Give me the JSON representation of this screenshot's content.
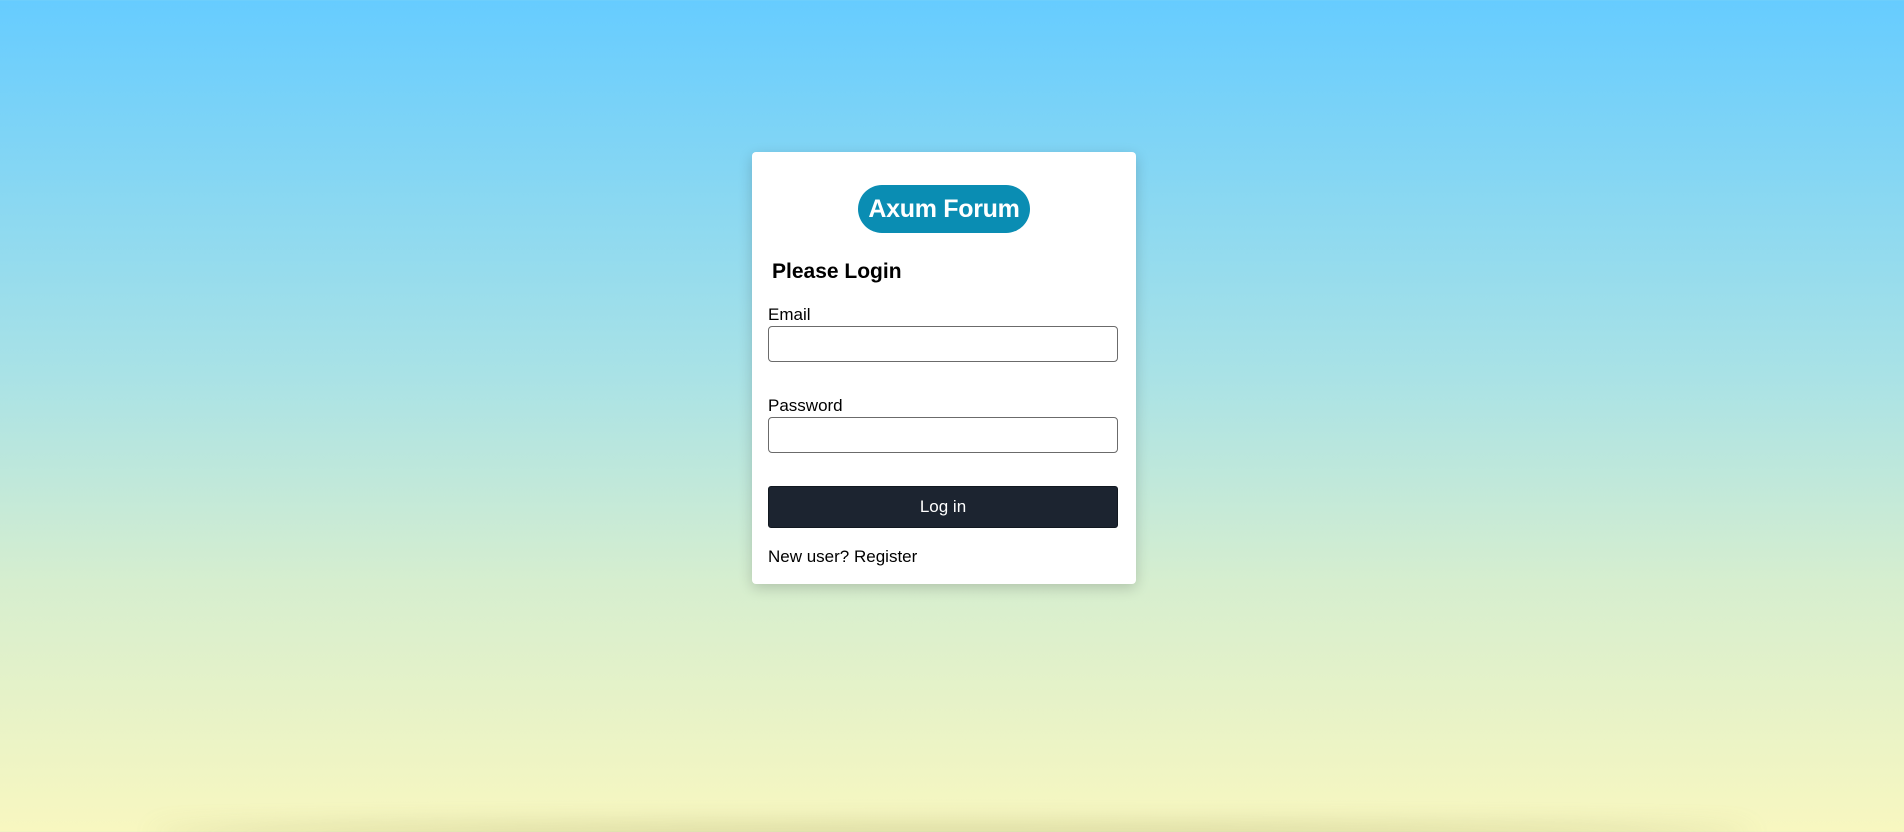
{
  "app": {
    "logo_text": "Axum Forum"
  },
  "login": {
    "heading": "Please Login",
    "email_label": "Email",
    "email_value": "",
    "password_label": "Password",
    "password_value": "",
    "submit_label": "Log in",
    "new_user_text": "New user?",
    "register_label": "Register"
  },
  "colors": {
    "logo_bg": "#0a8db3",
    "button_bg": "#1c2430",
    "gradient_top": "#66ccff",
    "gradient_bottom": "#f8f7c0"
  }
}
